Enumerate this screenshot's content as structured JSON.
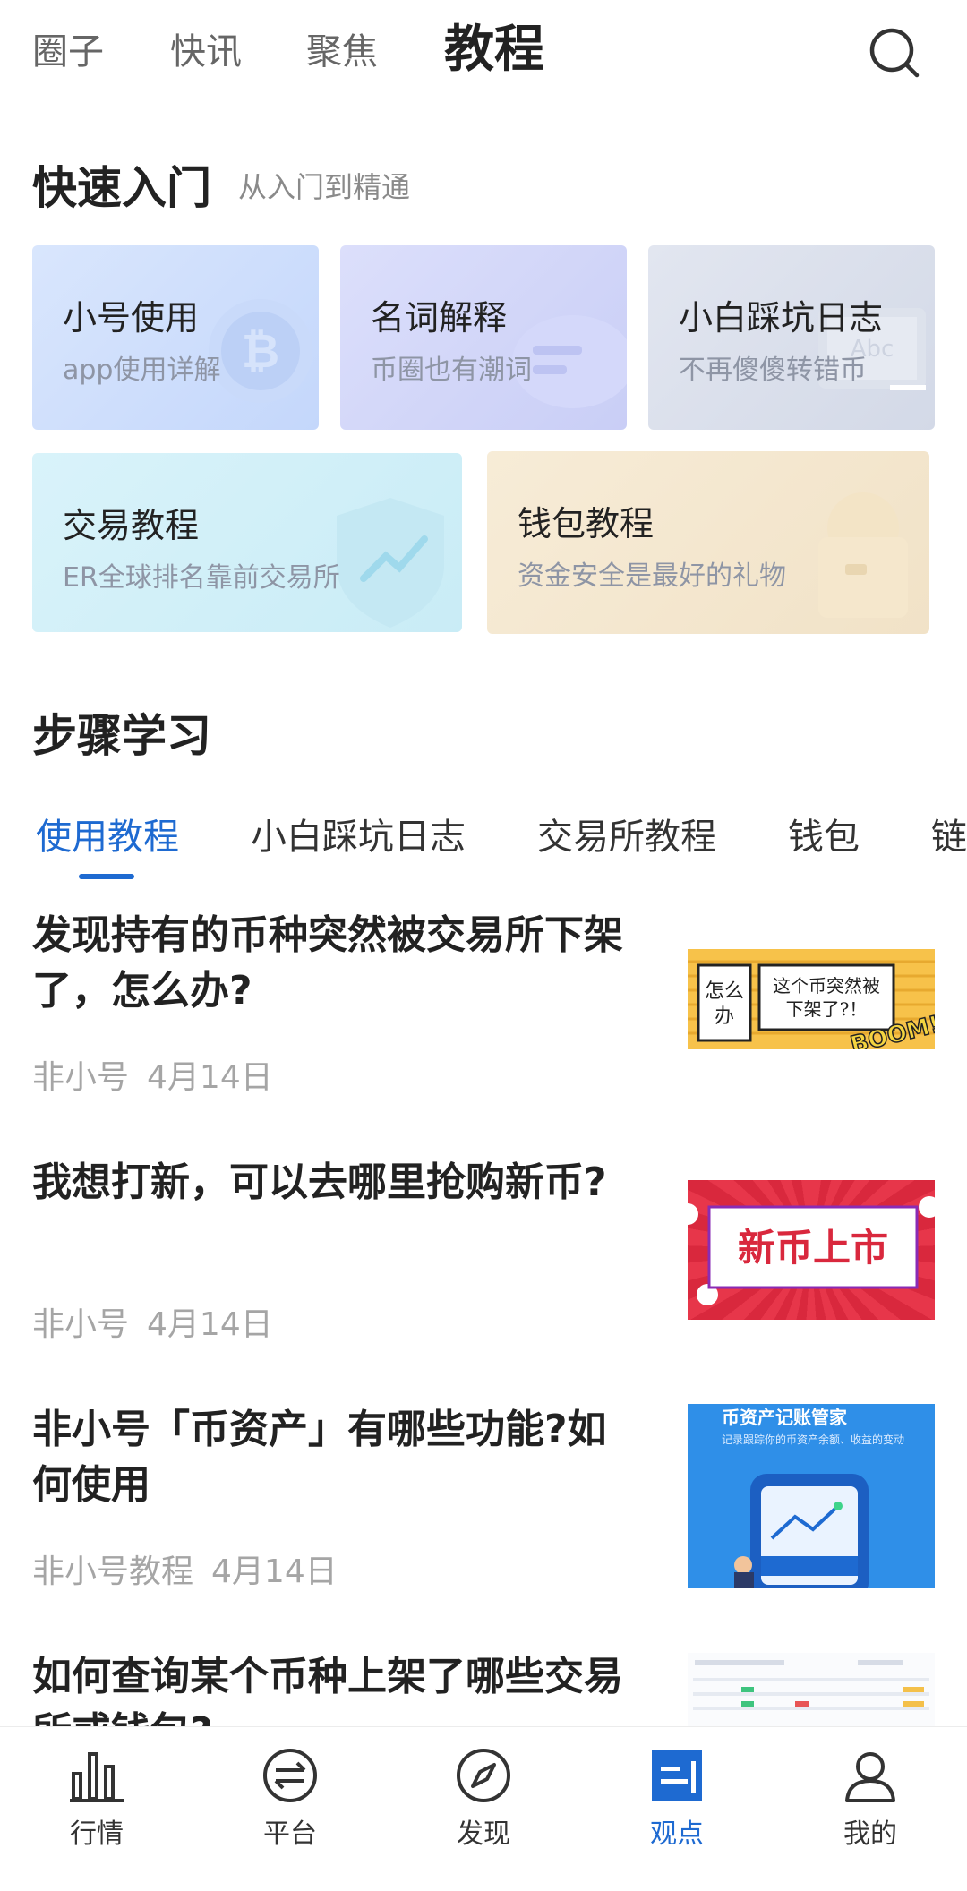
{
  "top_tabs": [
    "圈子",
    "快讯",
    "聚焦",
    "教程"
  ],
  "quick_start": {
    "title": "快速入门",
    "subtitle": "从入门到精通",
    "cards": [
      {
        "title": "小号使用",
        "subtitle": "app使用详解",
        "icon": "bitcoin-coin-icon"
      },
      {
        "title": "名词解释",
        "subtitle": "币圈也有潮词",
        "icon": "chat-bubble-icon"
      },
      {
        "title": "小白踩坑日志",
        "subtitle": "不再傻傻转错币",
        "icon": "laptop-icon"
      },
      {
        "title": "交易教程",
        "subtitle": "ER全球排名靠前交易所",
        "icon": "shield-chart-icon"
      },
      {
        "title": "钱包教程",
        "subtitle": "资金安全是最好的礼物",
        "icon": "wallet-icon"
      }
    ]
  },
  "step_learning": {
    "title": "步骤学习",
    "tabs": [
      "使用教程",
      "小白踩坑日志",
      "交易所教程",
      "钱包",
      "链"
    ]
  },
  "articles": [
    {
      "title": "发现持有的币种突然被交易所下架了，怎么办?",
      "author": "非小号",
      "date": "4月14日",
      "thumb": {
        "left_text_1": "怎么",
        "left_text_2": "办",
        "right_text_1": "这个币突然被",
        "right_text_2": "下架了?！",
        "burst": "BOOM!"
      }
    },
    {
      "title": "我想打新，可以去哪里抢购新币?",
      "author": "非小号",
      "date": "4月14日",
      "thumb": {
        "text": "新币上市"
      }
    },
    {
      "title": "非小号「币资产」有哪些功能?如何使用",
      "author": "非小号教程",
      "date": "4月14日",
      "thumb": {
        "heading": "币资产记账管家",
        "caption": "记录跟踪你的币资产余额、收益的变动"
      }
    },
    {
      "title": "如何查询某个币种上架了哪些交易所或钱包?",
      "author": "",
      "date": "",
      "thumb": {}
    }
  ],
  "bottom_nav": [
    {
      "label": "行情",
      "icon": "bar-chart-icon"
    },
    {
      "label": "平台",
      "icon": "exchange-icon"
    },
    {
      "label": "发现",
      "icon": "compass-icon"
    },
    {
      "label": "观点",
      "icon": "viewpoint-icon"
    },
    {
      "label": "我的",
      "icon": "user-icon"
    }
  ],
  "colors": {
    "accent": "#1e6ad1",
    "text": "#222222",
    "muted": "#a5a5a5"
  }
}
